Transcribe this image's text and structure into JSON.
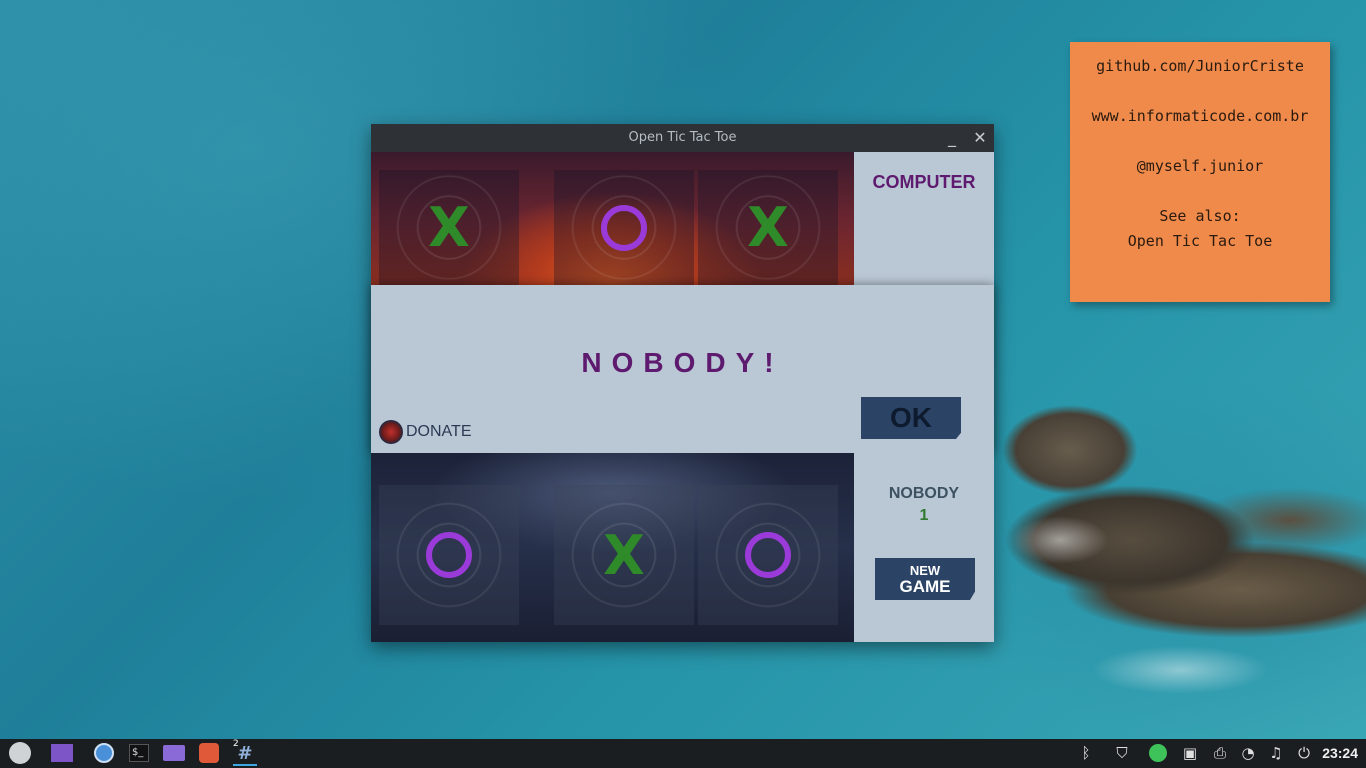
{
  "note": {
    "lines": [
      "github.com/JuniorCriste",
      "www.informaticode.com.br",
      "@myself.junior",
      "See also:",
      "Open Tic Tac Toe"
    ]
  },
  "window": {
    "title": "Open Tic Tac Toe",
    "minimize_icon": "minimize-icon",
    "close_icon": "close-icon"
  },
  "top_row": {
    "cells": [
      "X",
      "O",
      "X"
    ],
    "player_label": "COMPUTER"
  },
  "bottom_row": {
    "cells": [
      "O",
      "X",
      "O"
    ]
  },
  "score": {
    "name": "NOBODY",
    "value": "1"
  },
  "new_game": {
    "line1": "NEW",
    "line2": "GAME"
  },
  "dialog": {
    "result": "NOBODY!",
    "ok": "OK",
    "donate": "DONATE"
  },
  "taskbar": {
    "launchers": [
      "menu-icon",
      "workspace-icon",
      "chromium-icon",
      "terminal-icon",
      "files-icon",
      "game-icon",
      "tictactoe-icon"
    ],
    "tictactoe_badge": "2",
    "tray": [
      "bluetooth-icon",
      "shield-icon",
      "whatsapp-icon",
      "screenshot-icon",
      "printer-icon",
      "wifi-icon",
      "music-icon",
      "power-icon"
    ],
    "clock": "23:24"
  },
  "colors": {
    "accent_purple": "#5e1a6e",
    "x_green": "#2f8a2a",
    "o_purple": "#9a3ad8",
    "button_blue": "#2b4466"
  }
}
